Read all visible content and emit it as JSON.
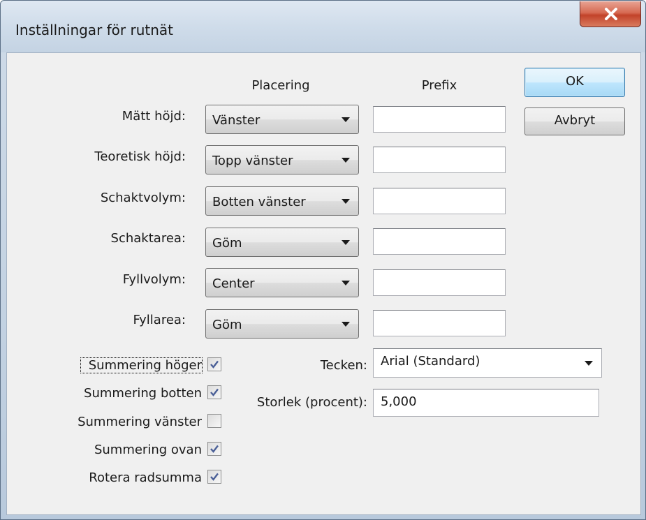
{
  "window": {
    "title": "Inställningar för rutnät",
    "close_icon": "close-x-icon"
  },
  "columns": {
    "placement": "Placering",
    "prefix": "Prefix"
  },
  "rows": [
    {
      "label": "Mätt höjd:",
      "placement": "Vänster",
      "prefix": ""
    },
    {
      "label": "Teoretisk höjd:",
      "placement": "Topp vänster",
      "prefix": ""
    },
    {
      "label": "Schaktvolym:",
      "placement": "Botten vänster",
      "prefix": ""
    },
    {
      "label": "Schaktarea:",
      "placement": "Göm",
      "prefix": ""
    },
    {
      "label": "Fyllvolym:",
      "placement": "Center",
      "prefix": ""
    },
    {
      "label": "Fyllarea:",
      "placement": "Göm",
      "prefix": ""
    }
  ],
  "buttons": {
    "ok": "OK",
    "cancel": "Avbryt"
  },
  "checkboxes": [
    {
      "label": "Summering höger",
      "checked": true
    },
    {
      "label": "Summering botten",
      "checked": true
    },
    {
      "label": "Summering vänster",
      "checked": false
    },
    {
      "label": "Summering ovan",
      "checked": true
    },
    {
      "label": "Rotera radsumma",
      "checked": true
    }
  ],
  "font": {
    "label": "Tecken:",
    "value": "Arial (Standard)"
  },
  "size": {
    "label": "Storlek (procent):",
    "value": "5,000"
  },
  "colors": {
    "accent": "#3c7fb1",
    "close_button": "#c2432a",
    "checkmark": "#4a5f97"
  }
}
